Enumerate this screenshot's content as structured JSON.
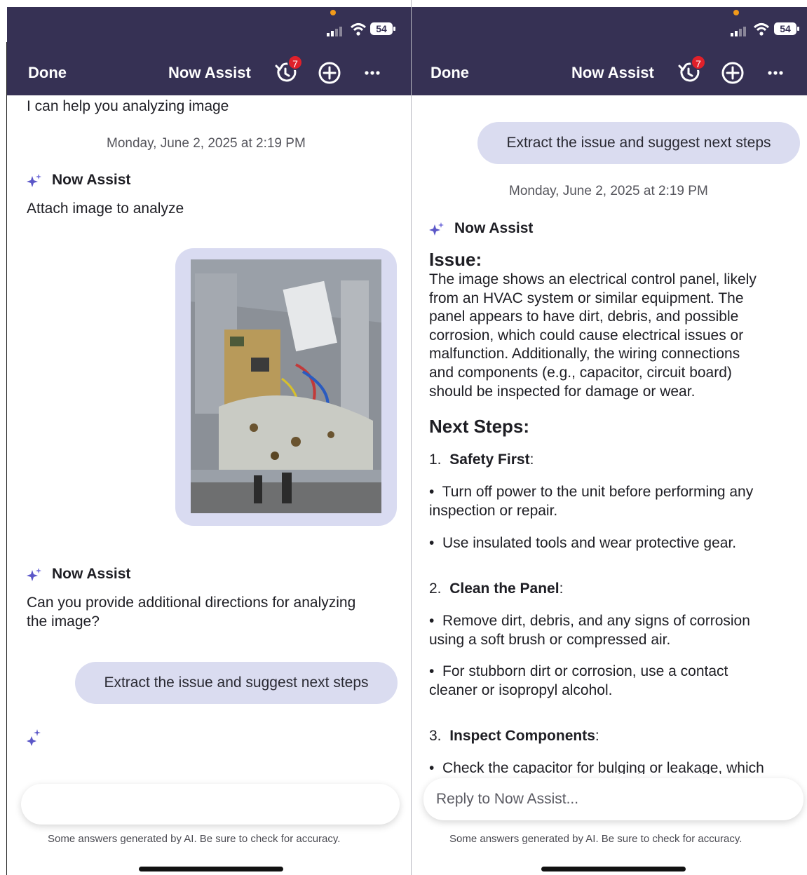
{
  "colors": {
    "header_bg": "#363154",
    "bubble_bg": "#dadcf0",
    "badge": "#e0202a",
    "accent_star": "#5b57c8"
  },
  "left": {
    "status": {
      "battery": "54"
    },
    "header": {
      "done": "Done",
      "title": "Now Assist",
      "badge": "7"
    },
    "messages": {
      "intro": "I can help you analyzing image",
      "timestamp": "Monday, June 2, 2025 at 2:19 PM",
      "agent1_name": "Now Assist",
      "agent1_text": "Attach image to analyze",
      "agent2_name": "Now Assist",
      "agent2_text_line1": "Can you provide additional directions for analyzing",
      "agent2_text_line2": "the image?",
      "user_bubble": "Extract the issue and suggest next steps"
    },
    "input": {
      "placeholder": ""
    },
    "disclaimer": "Some answers generated by AI. Be sure to check for accuracy."
  },
  "right": {
    "status": {
      "battery": "54"
    },
    "header": {
      "done": "Done",
      "title": "Now Assist",
      "badge": "7"
    },
    "messages": {
      "user_bubble": "Extract the issue and suggest next steps",
      "timestamp": "Monday, June 2, 2025 at 2:19 PM",
      "agent_name": "Now Assist",
      "issue_heading": "Issue:",
      "issue_lines": [
        "The image shows an electrical control panel, likely",
        "from an HVAC system or similar equipment. The",
        "panel appears to have dirt, debris, and possible",
        "corrosion, which could cause electrical issues or",
        "malfunction. Additionally, the wiring connections",
        "and components (e.g., capacitor, circuit board)",
        "should be inspected for damage or wear."
      ],
      "next_heading": "Next Steps:",
      "step1_num": "1.",
      "step1_title": "Safety First",
      "step1_b1_l1": "Turn off power to the unit before performing any",
      "step1_b1_l2": "inspection or repair.",
      "step1_b2": "Use insulated tools and wear protective gear.",
      "step2_num": "2.",
      "step2_title": "Clean the Panel",
      "step2_b1_l1": "Remove dirt, debris, and any signs of corrosion",
      "step2_b1_l2": "using a soft brush or compressed air.",
      "step2_b2_l1": "For stubborn dirt or corrosion, use a contact",
      "step2_b2_l2": "cleaner or isopropyl alcohol.",
      "step3_num": "3.",
      "step3_title": "Inspect Components",
      "step3_b1": "Check the capacitor for bulging or leakage, which",
      "colon": ":",
      "bullet": "•"
    },
    "input": {
      "placeholder": "Reply to Now Assist..."
    },
    "disclaimer": "Some answers generated by AI. Be sure to check for accuracy."
  }
}
